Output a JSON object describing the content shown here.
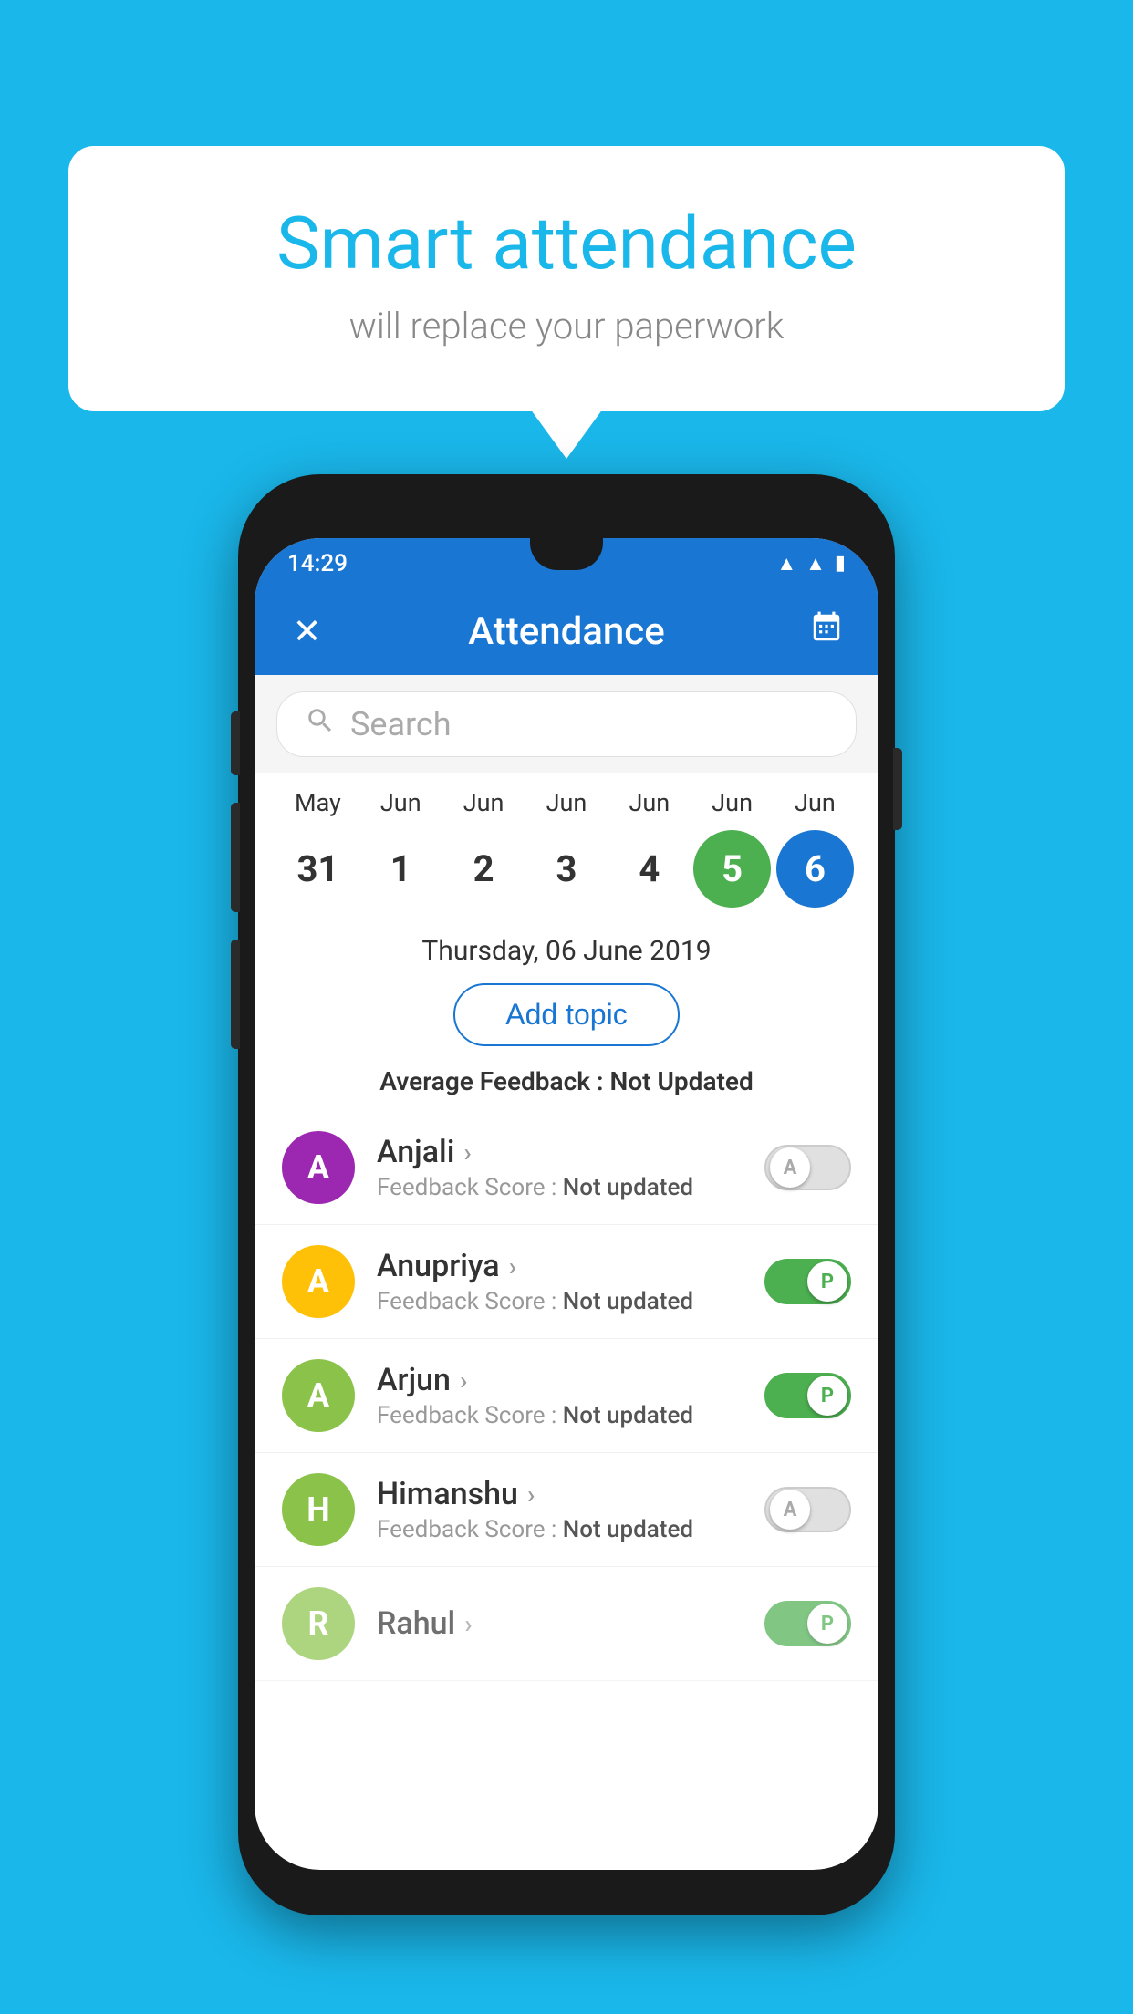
{
  "background_color": "#1ab7ea",
  "speech_bubble": {
    "title": "Smart attendance",
    "subtitle": "will replace your paperwork"
  },
  "phone": {
    "status_bar": {
      "time": "14:29",
      "icons": [
        "wifi",
        "signal",
        "battery"
      ]
    },
    "app_bar": {
      "title": "Attendance",
      "close_icon": "✕",
      "calendar_icon": "📅"
    },
    "search": {
      "placeholder": "Search"
    },
    "calendar": {
      "months": [
        "May",
        "Jun",
        "Jun",
        "Jun",
        "Jun",
        "Jun",
        "Jun"
      ],
      "days": [
        {
          "day": "31",
          "state": "normal"
        },
        {
          "day": "1",
          "state": "normal"
        },
        {
          "day": "2",
          "state": "normal"
        },
        {
          "day": "3",
          "state": "normal"
        },
        {
          "day": "4",
          "state": "normal"
        },
        {
          "day": "5",
          "state": "active-green"
        },
        {
          "day": "6",
          "state": "active-blue"
        }
      ]
    },
    "selected_date": "Thursday, 06 June 2019",
    "add_topic_label": "Add topic",
    "average_feedback_label": "Average Feedback :",
    "average_feedback_value": "Not Updated",
    "students": [
      {
        "name": "Anjali",
        "avatar_letter": "A",
        "avatar_color": "#9c27b0",
        "feedback_label": "Feedback Score :",
        "feedback_value": "Not updated",
        "toggle_state": "off",
        "toggle_label": "A"
      },
      {
        "name": "Anupriya",
        "avatar_letter": "A",
        "avatar_color": "#ffc107",
        "feedback_label": "Feedback Score :",
        "feedback_value": "Not updated",
        "toggle_state": "on",
        "toggle_label": "P"
      },
      {
        "name": "Arjun",
        "avatar_letter": "A",
        "avatar_color": "#8bc34a",
        "feedback_label": "Feedback Score :",
        "feedback_value": "Not updated",
        "toggle_state": "on",
        "toggle_label": "P"
      },
      {
        "name": "Himanshu",
        "avatar_letter": "H",
        "avatar_color": "#8bc34a",
        "feedback_label": "Feedback Score :",
        "feedback_value": "Not updated",
        "toggle_state": "off",
        "toggle_label": "A"
      }
    ]
  }
}
